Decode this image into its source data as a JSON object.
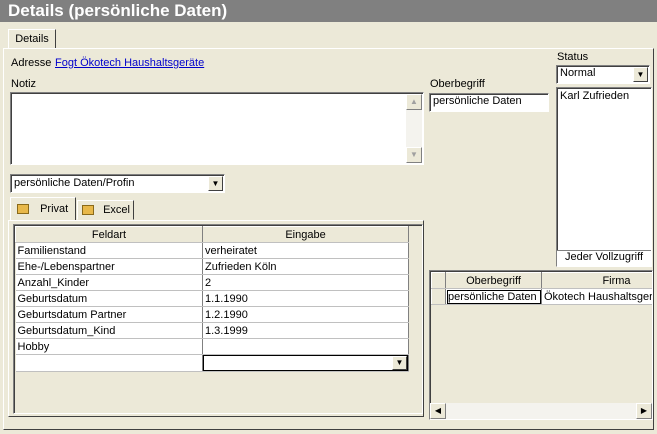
{
  "window": {
    "title": "Details (persönliche Daten)"
  },
  "tabs": [
    {
      "label": "Details"
    }
  ],
  "adresse": {
    "label": "Adresse",
    "link": "Fogt Ökotech Haushaltsgeräte"
  },
  "notiz": {
    "label": "Notiz",
    "value": ""
  },
  "oberbegriff": {
    "label": "Oberbegriff",
    "value": "persönliche Daten"
  },
  "status": {
    "label": "Status",
    "selected": "Normal",
    "list": [
      "Karl Zufrieden"
    ],
    "footer": "Jeder Vollzugriff"
  },
  "profile_select": {
    "selected": "persönliche Daten/Profin"
  },
  "subtabs": [
    {
      "label": "Privat",
      "icon": "folder-icon"
    },
    {
      "label": "Excel",
      "icon": "folder-icon"
    }
  ],
  "fields_table": {
    "headers": [
      "Feldart",
      "Eingabe"
    ],
    "rows": [
      [
        "Familienstand",
        "verheiratet"
      ],
      [
        "Ehe-/Lebenspartner",
        "Zufrieden  Köln"
      ],
      [
        "Anzahl_Kinder",
        "2"
      ],
      [
        "Geburtsdatum",
        "1.1.1990"
      ],
      [
        "Geburtsdatum Partner",
        "1.2.1990"
      ],
      [
        "Geburtsdatum_Kind",
        "1.3.1999"
      ],
      [
        "Hobby",
        ""
      ]
    ]
  },
  "right_table": {
    "headers": [
      "Oberbegriff",
      "Firma"
    ],
    "rows": [
      [
        "persönliche Daten",
        "Ökotech Haushaltsgeräte"
      ]
    ]
  }
}
